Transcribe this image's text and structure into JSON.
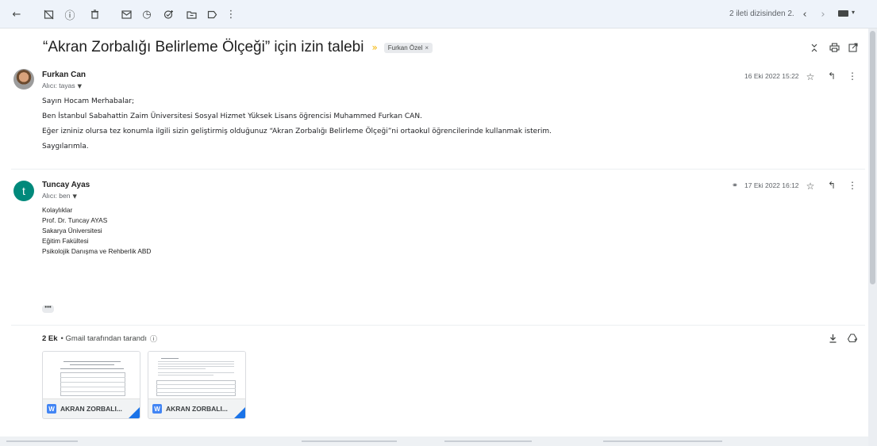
{
  "toolbar": {
    "pager_text": "2 ileti dizisinden 2."
  },
  "thread": {
    "subject": "“Akran Zorbalığı Belirleme Ölçeği” için izin talebi",
    "label": "Furkan Özel",
    "label_close": "×"
  },
  "messages": [
    {
      "sender": "Furkan Can",
      "to": "Alıcı: tayas",
      "date": "16 Eki 2022 15:22",
      "lines": [
        "Sayın Hocam Merhabalar;",
        "Ben İstanbul Sabahattin Zaim Üniversitesi Sosyal Hizmet Yüksek Lisans öğrencisi Muhammed Furkan CAN.",
        "Eğer izniniz olursa tez konumla ilgili sizin geliştirmiş olduğunuz “Akran Zorbalığı Belirleme Ölçeği”ni ortaokul öğrencilerinde kullanmak isterim.",
        "Saygılarımla."
      ]
    },
    {
      "sender": "Tuncay Ayas",
      "avatar_letter": "t",
      "to": "Alıcı: ben",
      "date": "17 Eki 2022 16:12",
      "lines": [
        "Kolaylıklar",
        "Prof. Dr. Tuncay AYAS",
        "Sakarya Üniversitesi",
        "Eğitim Fakültesi",
        "Psikolojik Danışma ve Rehberlik ABD"
      ]
    }
  ],
  "ellipsis": "•••",
  "attachments": {
    "count": "2 Ek",
    "scanned": "• Gmail tarafından tarandı",
    "items": [
      {
        "name": "AKRAN ZORBALI...",
        "type": "W"
      },
      {
        "name": "AKRAN ZORBALI...",
        "type": "W"
      }
    ]
  },
  "colors": {
    "topbar_bg": "#eef3fa",
    "avatar_teal": "#00897b",
    "important_yellow": "#f4b400",
    "word_blue": "#4285f4"
  }
}
